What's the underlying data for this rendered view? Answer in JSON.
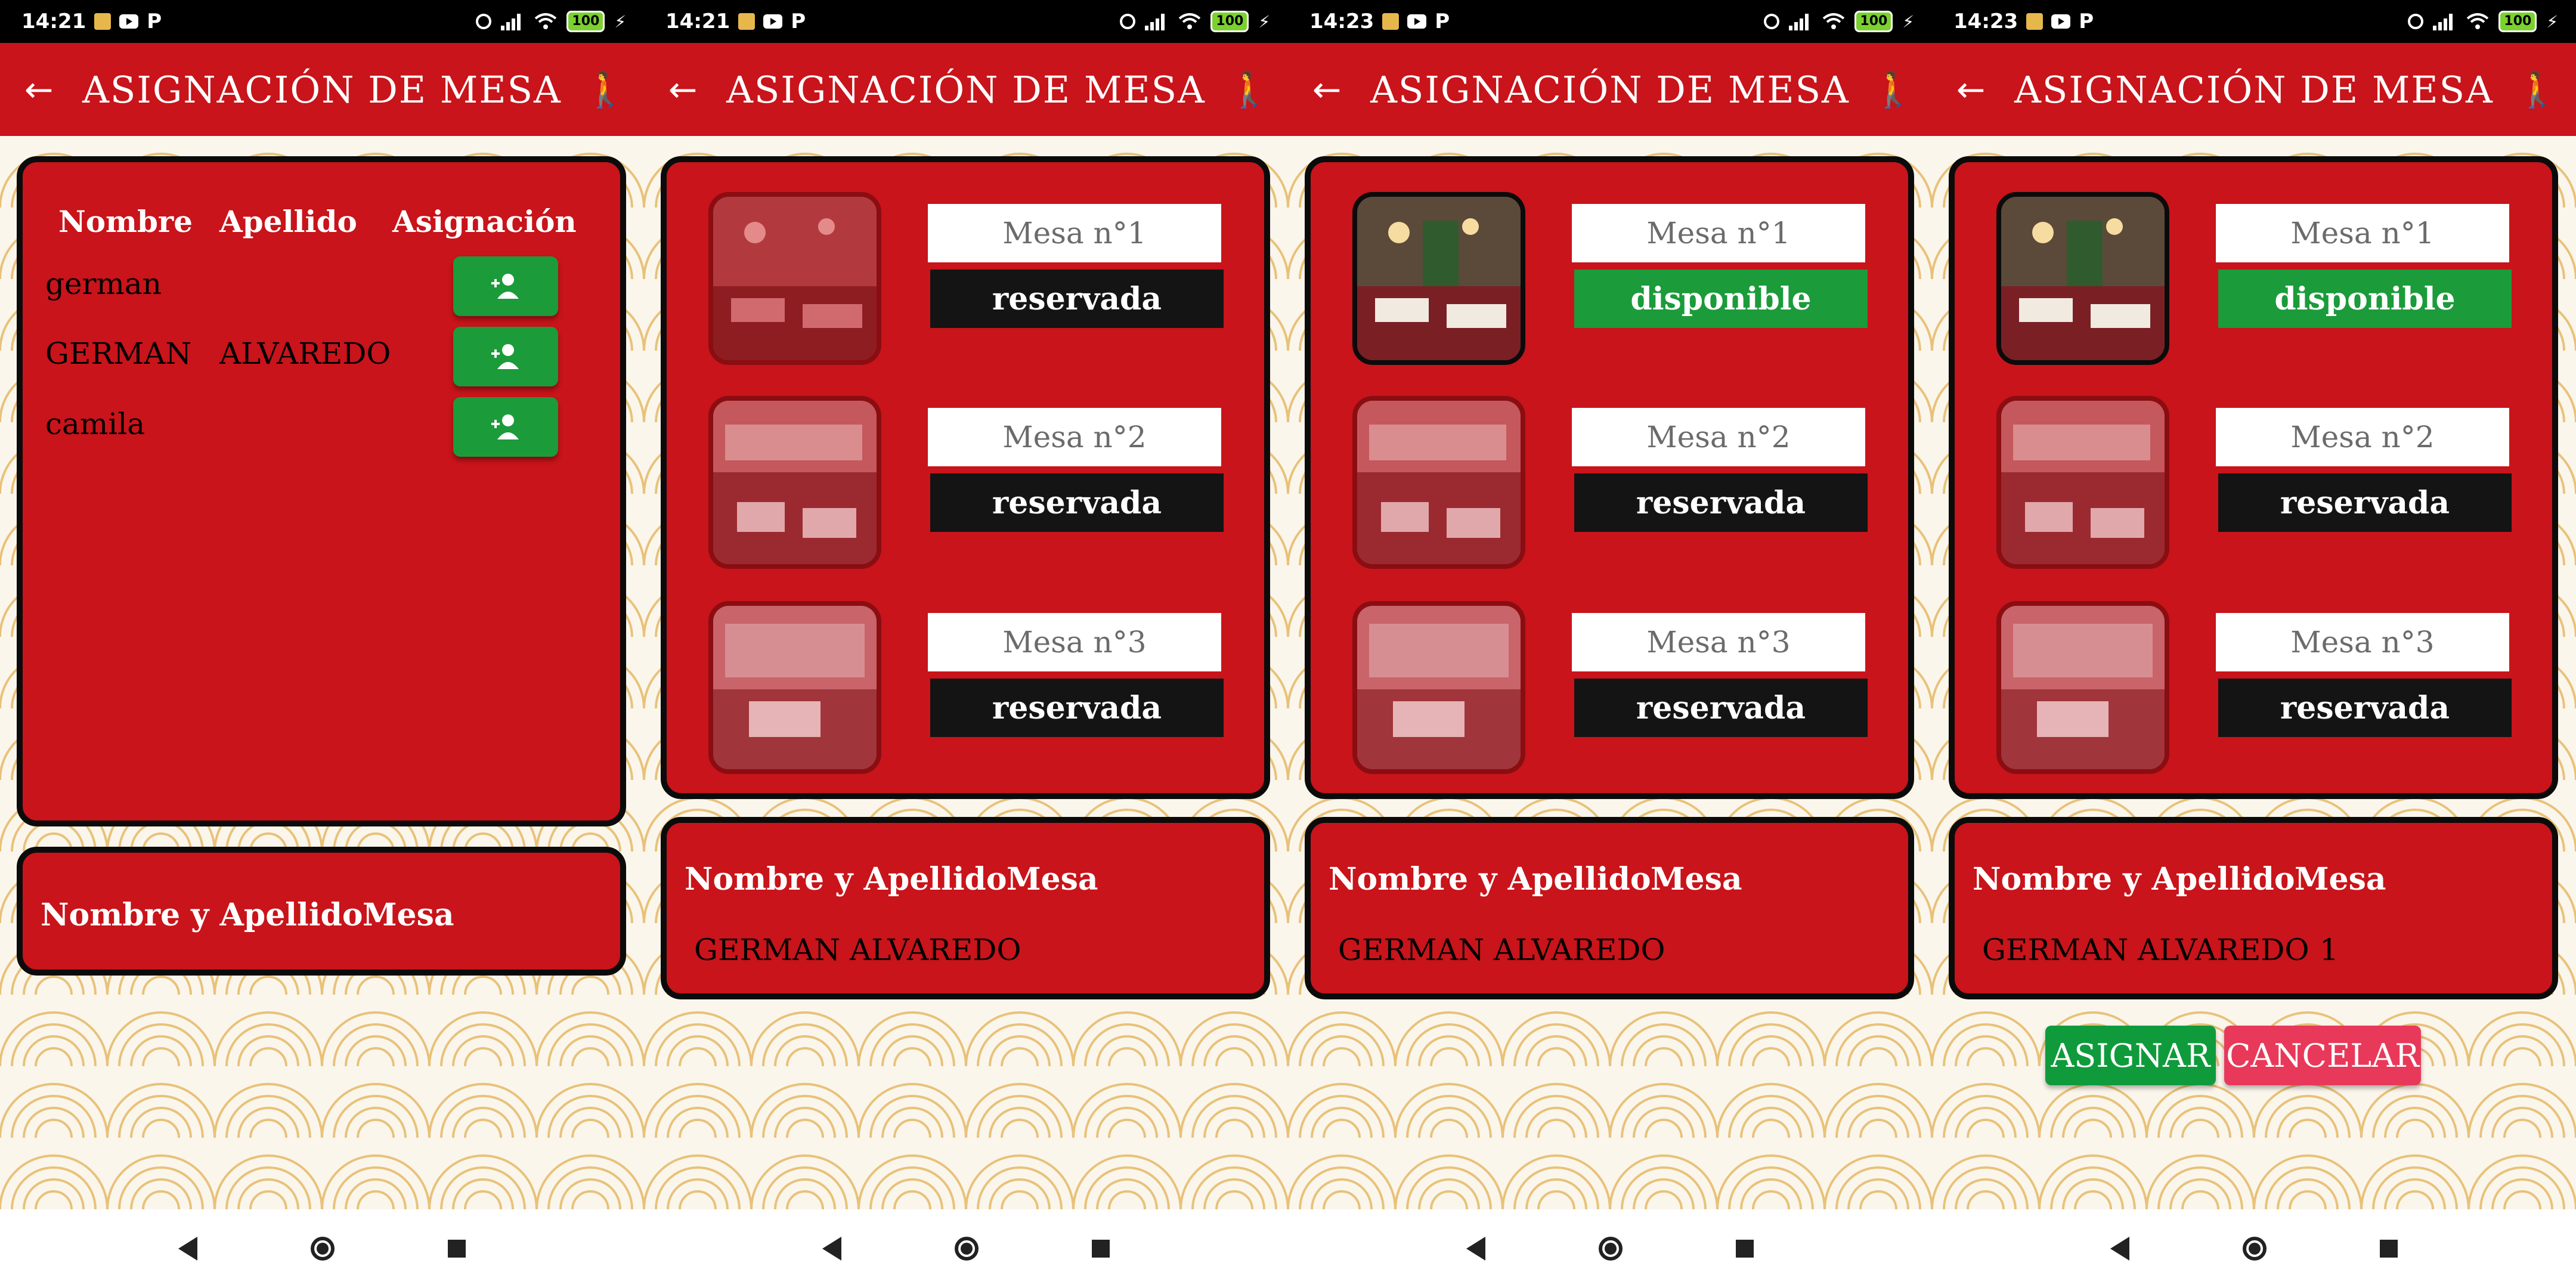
{
  "screens": [
    {
      "status": {
        "time": "14:21",
        "battery": "100"
      },
      "appbar": {
        "title": "ASIGNACIÓN DE MESA"
      },
      "table": {
        "headers": {
          "nombre": "Nombre",
          "apellido": "Apellido",
          "asignacion": "Asignación"
        },
        "rows": [
          {
            "nombre": "german",
            "apellido": ""
          },
          {
            "nombre": "GERMAN",
            "apellido": "ALVAREDO"
          },
          {
            "nombre": "camila",
            "apellido": ""
          }
        ]
      },
      "summary": {
        "header_name": "Nombre y Apellido",
        "header_mesa": "Mesa",
        "name": "",
        "mesa": ""
      }
    },
    {
      "status": {
        "time": "14:21",
        "battery": "100"
      },
      "appbar": {
        "title": "ASIGNACIÓN DE MESA"
      },
      "mesas": [
        {
          "label": "Mesa n°1",
          "status": "reservada",
          "state": "reservada"
        },
        {
          "label": "Mesa n°2",
          "status": "reservada",
          "state": "reservada"
        },
        {
          "label": "Mesa n°3",
          "status": "reservada",
          "state": "reservada"
        }
      ],
      "summary": {
        "header_name": "Nombre y Apellido",
        "header_mesa": "Mesa",
        "name": "GERMAN ALVAREDO",
        "mesa": ""
      }
    },
    {
      "status": {
        "time": "14:23",
        "battery": "100"
      },
      "appbar": {
        "title": "ASIGNACIÓN DE MESA"
      },
      "mesas": [
        {
          "label": "Mesa n°1",
          "status": "disponible",
          "state": "disponible"
        },
        {
          "label": "Mesa n°2",
          "status": "reservada",
          "state": "reservada"
        },
        {
          "label": "Mesa n°3",
          "status": "reservada",
          "state": "reservada"
        }
      ],
      "summary": {
        "header_name": "Nombre y Apellido",
        "header_mesa": "Mesa",
        "name": "GERMAN ALVAREDO",
        "mesa": ""
      }
    },
    {
      "status": {
        "time": "14:23",
        "battery": "100"
      },
      "appbar": {
        "title": "ASIGNACIÓN DE MESA"
      },
      "mesas": [
        {
          "label": "Mesa n°1",
          "status": "disponible",
          "state": "disponible"
        },
        {
          "label": "Mesa n°2",
          "status": "reservada",
          "state": "reservada"
        },
        {
          "label": "Mesa n°3",
          "status": "reservada",
          "state": "reservada"
        }
      ],
      "summary": {
        "header_name": "Nombre y Apellido",
        "header_mesa": "Mesa",
        "name": "GERMAN ALVAREDO",
        "mesa": "1"
      },
      "actions": {
        "assign": "ASIGNAR",
        "cancel": "CANCELAR"
      }
    }
  ],
  "colors": {
    "primary_red": "#c8141a",
    "available_green": "#1b9b3a",
    "reserved_black": "#141414",
    "cancel_pink": "#e8395a"
  },
  "icons": [
    "back-arrow-icon",
    "walking-person-icon",
    "add-person-icon",
    "alarm-icon",
    "signal-icon",
    "wifi-icon",
    "battery-icon",
    "nav-back-icon",
    "nav-home-icon",
    "nav-recent-icon"
  ]
}
